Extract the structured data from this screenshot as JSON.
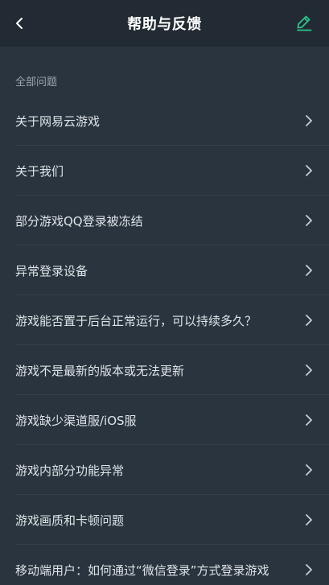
{
  "header": {
    "title": "帮助与反馈",
    "back_icon": "chevron-left-icon",
    "edit_icon": "pencil-edit-icon",
    "accent_color": "#2fc28a"
  },
  "section": {
    "label": "全部问题"
  },
  "items": [
    {
      "label": "关于网易云游戏"
    },
    {
      "label": "关于我们"
    },
    {
      "label": "部分游戏QQ登录被冻结"
    },
    {
      "label": "异常登录设备"
    },
    {
      "label": "游戏能否置于后台正常运行，可以持续多久？"
    },
    {
      "label": "游戏不是最新的版本或无法更新"
    },
    {
      "label": "游戏缺少渠道服/iOS服"
    },
    {
      "label": "游戏内部分功能异常"
    },
    {
      "label": "游戏画质和卡顿问题"
    },
    {
      "label": "移动端用户：如何通过“微信登录”方式登录游戏"
    }
  ]
}
